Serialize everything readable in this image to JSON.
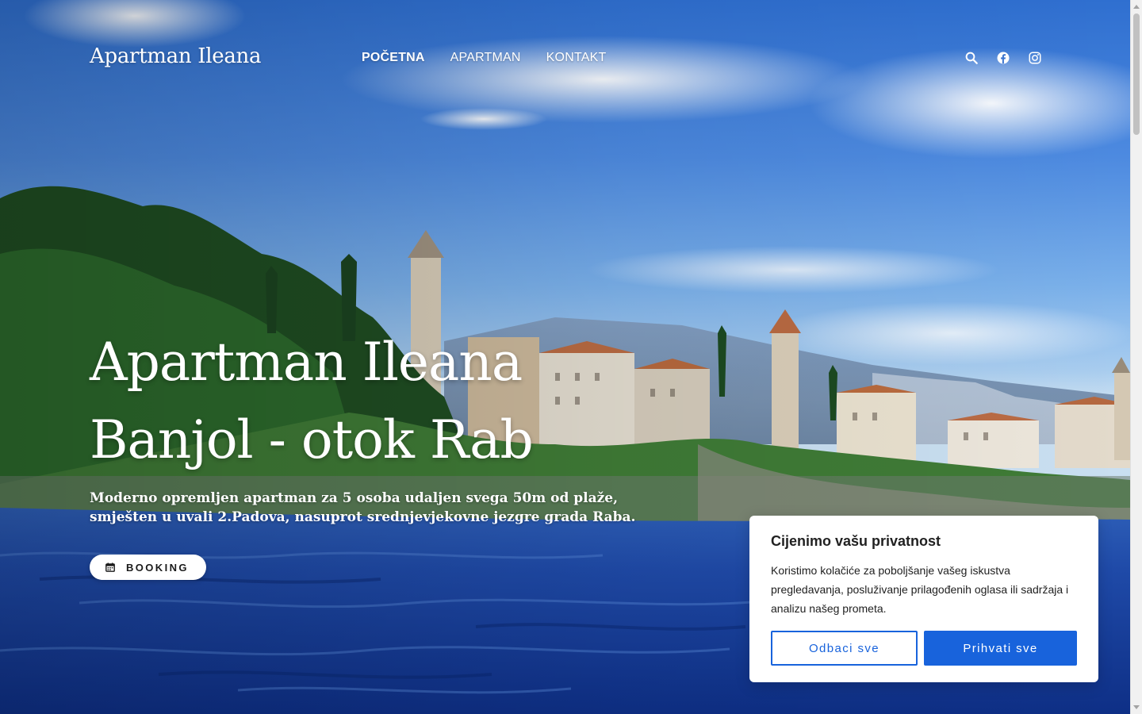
{
  "header": {
    "logo": "Apartman Ileana",
    "nav": [
      {
        "label": "POČETNA",
        "active": true
      },
      {
        "label": "APARTMAN",
        "active": false
      },
      {
        "label": "KONTAKT",
        "active": false
      }
    ],
    "icons": [
      "search-icon",
      "facebook-icon",
      "instagram-icon"
    ]
  },
  "hero": {
    "title_line1": "Apartman Ileana",
    "title_line2": "Banjol - otok Rab",
    "subtitle_line1": "Moderno opremljen apartman za 5 osoba udaljen svega 50m od plaže,",
    "subtitle_line2": "smješten u uvali 2.Padova, nasuprot srednjevjekovne jezgre grada Raba.",
    "booking_label": "BOOKING",
    "booking_icon": "calendar-icon"
  },
  "cookie": {
    "title": "Cijenimo vašu privatnost",
    "text": "Koristimo kolačiće za poboljšanje vašeg iskustva pregledavanja, posluživanje prilagođenih oglasa ili sadržaja i analizu našeg prometa.",
    "reject_label": "Odbaci sve",
    "accept_label": "Prihvati sve"
  },
  "colors": {
    "accent": "#1863dc",
    "text_on_hero": "#ffffff"
  }
}
